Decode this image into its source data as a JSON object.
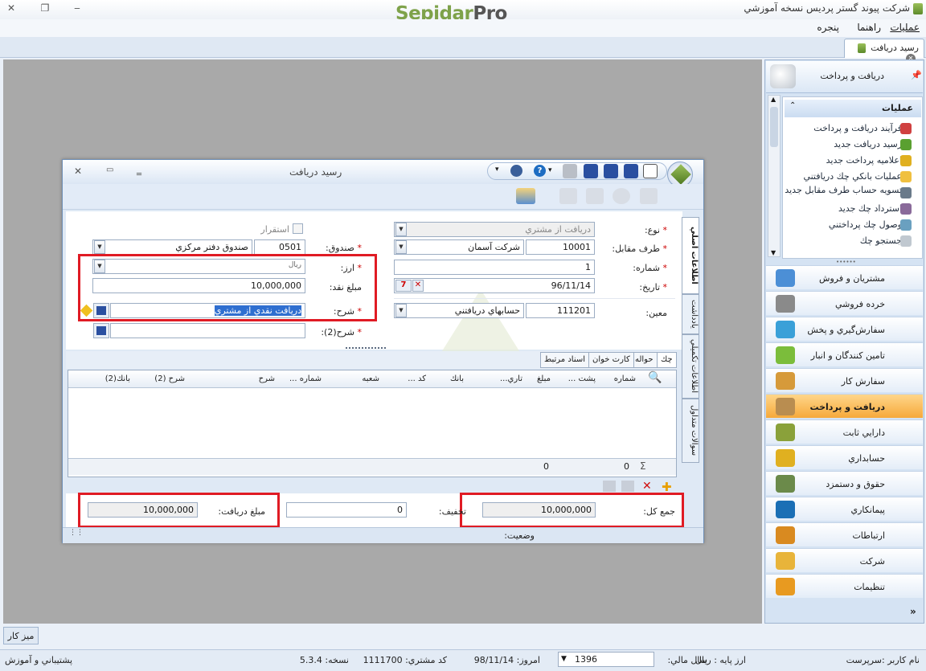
{
  "app": {
    "title": "شرکت پیوند گستر پردیس نسخه آموزشي",
    "logo_part1": "Sepidar",
    "logo_part2": "Pro",
    "minimize": "‒",
    "restore": "❐",
    "close": "✕"
  },
  "menu": {
    "operations": "عمليات",
    "help": "راهنما",
    "window": "پنجره"
  },
  "doc_tab": {
    "label": "رسيد دريافت"
  },
  "desk_button": "ميز كار",
  "dialog": {
    "title": "رسيد دريافت",
    "form": {
      "type_label": "نوع:",
      "type_value": "دريافت از مشتري",
      "counterparty_label": "طرف مقابل:",
      "counterparty_code": "10001",
      "counterparty_name": "شرکت آسمان",
      "number_label": "شماره:",
      "number_value": "1",
      "date_label": "تاريخ:",
      "date_value": "96/11/14",
      "account_label": "معين:",
      "account_code": "111201",
      "account_name": "حسابهاي دريافتني",
      "settle_label": "استقرار",
      "fund_label": "صندوق:",
      "fund_code": "0501",
      "fund_name": "صندوق دفتر مرکزي",
      "currency_label": "ارز:",
      "currency_value": "ريال",
      "cash_label": "مبلغ نقد:",
      "cash_value": "10,000,000",
      "desc_label": "شرح:",
      "desc_value": "دريافت نقدي از مشتري",
      "desc2_label": "شرح(2):",
      "desc2_value": ""
    },
    "side_tabs": [
      "اطلاعات اصلي",
      "يادداشت",
      "اطلاعات تكميلي",
      "سوالات متداول"
    ],
    "grid_tabs": [
      "چك",
      "حواله",
      "كارت خوان",
      "اسناد مرتبط"
    ],
    "grid_headers": [
      "شماره",
      "پشت ...",
      "مبلغ",
      "تاري...",
      "بانك",
      "كد ...",
      "شعبه",
      "شماره ...",
      "شرح",
      "شرح (2)",
      "بانك(2)"
    ],
    "grid_sum": {
      "count": "0",
      "amount": "0",
      "sigma": "Σ"
    },
    "totals": {
      "total_label": "جمع کل:",
      "total_value": "10,000,000",
      "discount_label": "تخفيف:",
      "discount_value": "0",
      "received_label": "مبلغ دريافت:",
      "received_value": "10,000,000"
    },
    "status_label": "وضعيت:"
  },
  "right_panel": {
    "header": "دريافت و پرداخت",
    "ops_title": "عمليات",
    "ops": [
      "فرآيند دريافت و پرداخت",
      "رسيد دريافت جديد",
      "اعلاميه پرداخت جديد",
      "عمليات بانكي چك دريافتني",
      "تسويه حساب طرف مقابل جديد",
      "استرداد چك جديد",
      "وصول چك پرداختني",
      "جستجو چك"
    ],
    "nav": [
      "مشتريان و فروش",
      "خرده فروشي",
      "سفارش‌گيري و پخش",
      "تامين كنندگان و انبار",
      "سفارش كار",
      "دريافت و پرداخت",
      "دارايي ثابت",
      "حسابداري",
      "حقوق و دستمزد",
      "پيمانكاري",
      "ارتباطات",
      "شركت",
      "تنظيمات"
    ],
    "nav_icon_colors": [
      "#4c8fd6",
      "#8a8a8a",
      "#3aa0d8",
      "#7bbd3b",
      "#d69a3a",
      "#b98d50",
      "#8aa13a",
      "#e0b020",
      "#6b8a4a",
      "#1b6fb5",
      "#d98a20",
      "#e8b43a",
      "#e89a20"
    ]
  },
  "status_bar": {
    "user_label": "نام كاربر :",
    "user_value": "سرپرست",
    "base_currency_label": "ارز پايه :",
    "base_currency_value": "ريال",
    "fiscal_year_label": "سال مالي:",
    "fiscal_year_value": "1396",
    "today_label": "امروز:",
    "today_value": "98/11/14",
    "customer_code_label": "كد مشتري:",
    "customer_code_value": "1111700",
    "version_label": "نسخه:",
    "version_value": "5.3.4",
    "support": "پشتيباني و آموزش"
  }
}
